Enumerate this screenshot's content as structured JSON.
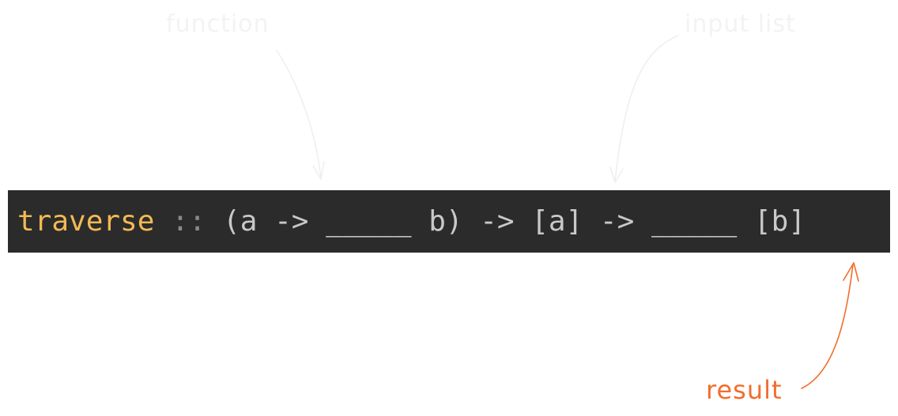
{
  "annotations": {
    "function": "function",
    "input_list": "input list",
    "result": "result"
  },
  "code": {
    "name": "traverse",
    "sep": " :: ",
    "open": "(a -> ",
    "hole1": "_____",
    "close": " b) -> [a] -> ",
    "hole2": "_____",
    "ret": " [b]"
  },
  "colors": {
    "code_background": "#2b2b2b",
    "keyword": "#f4b953",
    "code_text": "#c9c9c9",
    "faint_annotation": "#f3f3f3",
    "result_annotation": "#f26d2c"
  }
}
